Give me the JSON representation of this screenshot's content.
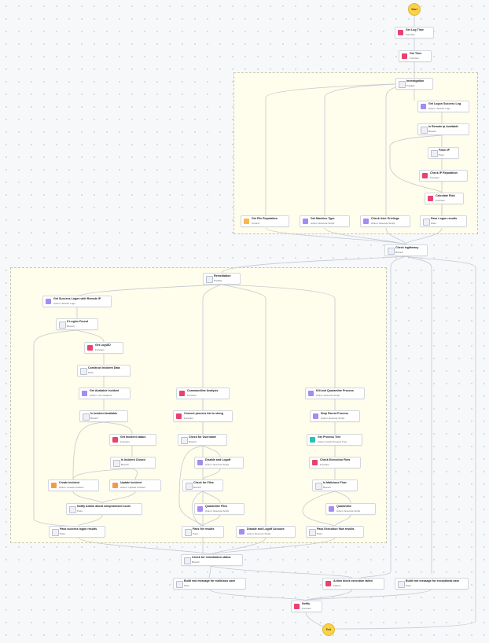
{
  "colors": {
    "function": "#e9426f",
    "action": "#a48cf0",
    "branch": "#eef0f6",
    "pass": "#eef0f6",
    "control": "#f7b84b",
    "action_orange": "#f39a4a",
    "action_teal": "#2cbfb4",
    "terminal": "#f9d34a"
  },
  "terminals": {
    "start": "Start",
    "end": "End"
  },
  "nodes": [
    {
      "id": "get-log-time",
      "title": "Get Log Time",
      "sub": "Function",
      "icon": "function"
    },
    {
      "id": "get-time",
      "title": "Get Time",
      "sub": "Function",
      "icon": "function"
    },
    {
      "id": "investigation",
      "title": "Investigation",
      "sub": "Parallel",
      "icon": "branch"
    },
    {
      "id": "get-logon-success-log",
      "title": "Get Logon Success Log",
      "sub": "Action: Search Logs",
      "icon": "action"
    },
    {
      "id": "is-remote-ip-available",
      "title": "Is Remote Ip Available",
      "sub": "Branch",
      "icon": "branch"
    },
    {
      "id": "fetch-ip",
      "title": "Fetch IP",
      "sub": "Pass",
      "icon": "pass"
    },
    {
      "id": "check-ip-reputation",
      "title": "Check IP Reputation",
      "sub": "Function",
      "icon": "function"
    },
    {
      "id": "calculate-risk",
      "title": "Calculate Risk",
      "sub": "Function",
      "icon": "function"
    },
    {
      "id": "get-file-reputation",
      "title": "Get File Reputation",
      "sub": "Control",
      "icon": "control"
    },
    {
      "id": "get-machine-type",
      "title": "Get Machine Type",
      "sub": "Action: Execute Script",
      "icon": "action"
    },
    {
      "id": "check-user-privilege",
      "title": "Check User Privilege",
      "sub": "Action: Execute Script",
      "icon": "action"
    },
    {
      "id": "pass-logon-results",
      "title": "Pass Logon results",
      "sub": "Pass",
      "icon": "pass"
    },
    {
      "id": "check-legitimacy",
      "title": "Check legitimacy",
      "sub": "Branch",
      "icon": "branch"
    },
    {
      "id": "remediation",
      "title": "Remediation",
      "sub": "Parallel",
      "icon": "branch"
    },
    {
      "id": "get-success-logon-remote-ip",
      "title": "Get Success Logon with Remote IP",
      "sub": "Action: Search Logs",
      "icon": "action"
    },
    {
      "id": "if-logins-found",
      "title": "If Logins Found",
      "sub": "Branch",
      "icon": "branch"
    },
    {
      "id": "get-log-uid",
      "title": "Get LogUID",
      "sub": "Function",
      "icon": "function"
    },
    {
      "id": "construct-incident-data",
      "title": "Construct Incident Data",
      "sub": "Pass",
      "icon": "pass"
    },
    {
      "id": "get-available-incident",
      "title": "Get Available Incident",
      "sub": "Action: List Incidents",
      "icon": "action"
    },
    {
      "id": "is-incident-available",
      "title": "Is Incident Available",
      "sub": "Branch",
      "icon": "branch"
    },
    {
      "id": "get-incident-status",
      "title": "Get Incident status",
      "sub": "Function",
      "icon": "function"
    },
    {
      "id": "is-incident-closed",
      "title": "Is Incident Closed",
      "sub": "Branch",
      "icon": "branch"
    },
    {
      "id": "create-incident",
      "title": "Create Incident",
      "sub": "Action: Create Incident",
      "icon": "action_orange"
    },
    {
      "id": "update-incident",
      "title": "Update Incident",
      "sub": "Action: Update Incident",
      "icon": "action_orange"
    },
    {
      "id": "notify-admin",
      "title": "Notify Admin about compromised score",
      "sub": "Pass",
      "icon": "pass"
    },
    {
      "id": "pass-success-logon",
      "title": "Pass success logon results",
      "sub": "Pass",
      "icon": "pass"
    },
    {
      "id": "commandline-analysis",
      "title": "Commandline Analysis",
      "sub": "Function",
      "icon": "function"
    },
    {
      "id": "convert-process-list",
      "title": "Convert process list to string",
      "sub": "Function",
      "icon": "function"
    },
    {
      "id": "check-for-username",
      "title": "Check for Username",
      "sub": "Branch",
      "icon": "branch"
    },
    {
      "id": "disable-and-logoff",
      "title": "Disable and Logoff",
      "sub": "Action: Execute Script",
      "icon": "action"
    },
    {
      "id": "check-for-files",
      "title": "Check for Files",
      "sub": "Branch",
      "icon": "branch"
    },
    {
      "id": "quarantine-files",
      "title": "Quarantine Files",
      "sub": "Action: Execute Script",
      "icon": "action"
    },
    {
      "id": "pass-file-results",
      "title": "Pass file results",
      "sub": "Pass",
      "icon": "pass"
    },
    {
      "id": "disable-logoff-account",
      "title": "Disable and Logoff Account",
      "sub": "Action: Execute Script",
      "icon": "action"
    },
    {
      "id": "kill-quarantine-process",
      "title": "Kill and Quarantine Process",
      "sub": "Action: Execute Script",
      "icon": "action"
    },
    {
      "id": "stop-parent-process",
      "title": "Stop Parent Process",
      "sub": "Action: Execute Script",
      "icon": "action"
    },
    {
      "id": "get-process-tree",
      "title": "Get Process Tree",
      "sub": "Action: Fetch Process Tree",
      "icon": "action_teal"
    },
    {
      "id": "check-execution-flow",
      "title": "Check Execution Flow",
      "sub": "Function",
      "icon": "function"
    },
    {
      "id": "is-malicious-flow",
      "title": "Is Malicious Flow",
      "sub": "Branch",
      "icon": "branch"
    },
    {
      "id": "quarantine",
      "title": "Quarantine",
      "sub": "Action: Execute Script",
      "icon": "action"
    },
    {
      "id": "pass-execution-flow",
      "title": "Pass Execution flow results",
      "sub": "Pass",
      "icon": "pass"
    },
    {
      "id": "check-remediation-status",
      "title": "Check for remediation status",
      "sub": "Branch",
      "icon": "branch"
    },
    {
      "id": "build-msg-malicious",
      "title": "Build end message for malicious case",
      "sub": "Pass",
      "icon": "pass"
    },
    {
      "id": "action-block-execution-failed",
      "title": "Action block execution failed",
      "sub": "Failure",
      "icon": "function"
    },
    {
      "id": "build-msg-exceptional",
      "title": "Build end message for exceptional case",
      "sub": "Pass",
      "icon": "pass"
    },
    {
      "id": "notify",
      "title": "Notify",
      "sub": "Function",
      "icon": "function"
    }
  ]
}
